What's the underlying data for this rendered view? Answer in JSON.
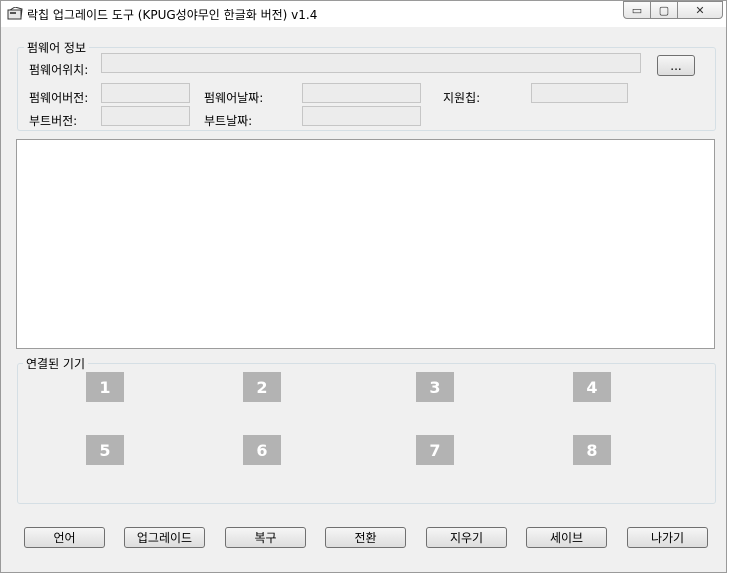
{
  "window": {
    "title": "락칩 업그레이드 도구 (KPUG성야무인 한글화 버전) v1.4",
    "controls": {
      "minimize": "▭",
      "maximize": "▢",
      "close": "✕"
    }
  },
  "firmware_info": {
    "group_label": "펌웨어 정보",
    "location_label": "펌웨어위치:",
    "location_value": "",
    "browse_label": "...",
    "fw_version_label": "펌웨어버전:",
    "fw_version_value": "",
    "fw_date_label": "펌웨어날짜:",
    "fw_date_value": "",
    "chip_label": "지원칩:",
    "chip_value": "",
    "boot_version_label": "부트버전:",
    "boot_version_value": "",
    "boot_date_label": "부트날짜:",
    "boot_date_value": ""
  },
  "log": {
    "text": ""
  },
  "devices": {
    "group_label": "연결된 기기",
    "slots": [
      "1",
      "2",
      "3",
      "4",
      "5",
      "6",
      "7",
      "8"
    ]
  },
  "buttons": {
    "language": "언어",
    "upgrade": "업그레이드",
    "restore": "복구",
    "switch": "전환",
    "erase": "지우기",
    "save": "세이브",
    "exit": "나가기"
  }
}
